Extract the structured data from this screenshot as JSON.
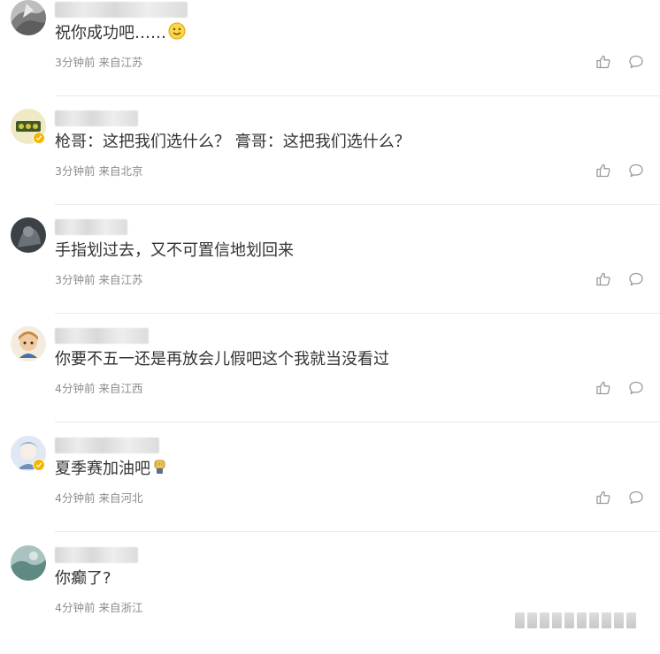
{
  "comments": [
    {
      "text": "祝你成功吧……",
      "time": "3分钟前",
      "location": "来自江苏",
      "emoji_after": "smile-emoji",
      "verified": false,
      "avatar_color": "#9a9a9a"
    },
    {
      "text": "枪哥：这把我们选什么？ 膏哥：这把我们选什么？",
      "time": "3分钟前",
      "location": "来自北京",
      "verified": true,
      "avatar_color": "#c9c28a"
    },
    {
      "text": "手指划过去，又不可置信地划回来",
      "time": "3分钟前",
      "location": "来自江苏",
      "verified": false,
      "avatar_color": "#4a5058"
    },
    {
      "text": "你要不五一还是再放会儿假吧这个我就当没看过",
      "time": "4分钟前",
      "location": "来自江西",
      "verified": false,
      "avatar_color": "#e9d2b0"
    },
    {
      "text": "夏季赛加油吧",
      "time": "4分钟前",
      "location": "来自河北",
      "emoji_after": "fist-emoji",
      "verified": true,
      "avatar_color": "#9bb4cf"
    },
    {
      "text": "你癫了?",
      "time": "4分钟前",
      "location": "来自浙江",
      "verified": false,
      "avatar_color": "#7fa3a0"
    }
  ],
  "colors": {
    "text": "#333333",
    "meta": "#8c8c8c",
    "icon": "#9a9a9a",
    "divider": "#eaeaea",
    "verified": "#f7b500"
  }
}
